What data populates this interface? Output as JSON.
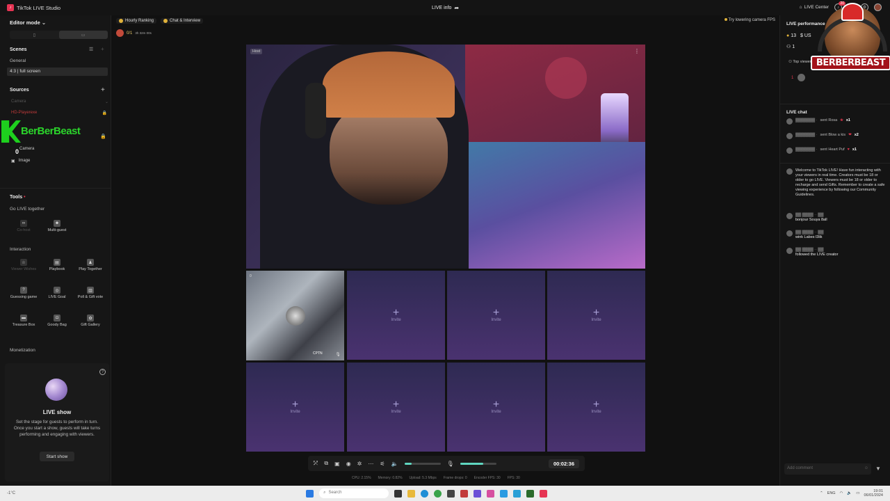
{
  "titlebar": {
    "app_title": "TikTok LIVE Studio",
    "center_title": "LIVE info",
    "live_center": "LIVE Center",
    "notification_count": "20"
  },
  "left": {
    "editor_mode": "Editor mode",
    "scenes_title": "Scenes",
    "scene_group": "General",
    "scene_item": "4:3 | full screen",
    "sources_title": "Sources",
    "sources": [
      "Camera",
      "HD-Playerexe",
      "Camera",
      "Image"
    ],
    "overlay_name": "BerBerBeast",
    "overlay_count": "0",
    "tools_title": "Tools",
    "go_live_together": "Go LIVE together",
    "tools_row1": [
      "Co-host",
      "Multi-guest"
    ],
    "interaction_title": "Interaction",
    "tools_interaction": [
      "Viewer Wishes",
      "Playbook",
      "Play Together",
      "Guessing game",
      "LIVE Goal",
      "Poll & Gift vote",
      "Treasure Box",
      "Goody Bag",
      "Gift Gallery"
    ],
    "monetization_title": "Monetization",
    "liveshow_title": "LIVE show",
    "liveshow_desc": "Set the stage for guests to perform in turn. Once you start a show, guests will take turns performing and engaging with viewers.",
    "start_show": "Start show"
  },
  "center": {
    "chips": [
      "Hourly Ranking",
      "Chat & Interview"
    ],
    "counter": "0/1",
    "counter_sub": "3h 32m 00s",
    "camera_tip": "Try lowering camera FPS",
    "cam_label": "Host",
    "invite_label": "Invite",
    "guest_count": "0",
    "guest_name": "CPTN",
    "timer": "00:02:36",
    "mic_level": 0.65,
    "vol_level": 0.2,
    "stats": [
      "CPU: 2.15%",
      "Memory: 0.82%",
      "Upload: 5.3 Mbps",
      "Frame drops: 0",
      "Encoder FPS: 30",
      "FPS: 30"
    ]
  },
  "right": {
    "perf_title": "LIVE performance",
    "perf_viewers": "13",
    "perf_currency": "US",
    "perf_row2": "1",
    "top_viewers": "Top viewers",
    "rank1": "1",
    "brand": "BERBERBEAST",
    "chat_title": "LIVE chat",
    "gifts": [
      {
        "text": "sent Rosa",
        "count": "x1"
      },
      {
        "text": "sent Blow a kis",
        "count": "x2"
      },
      {
        "text": "sent Heart Puf",
        "count": "x1"
      }
    ],
    "welcome": "Welcome to TikTok LIVE! Have fun interacting with your viewers in real time. Creators must be 18 or older to go LIVE. Viewers must be 18 or older to recharge and send Gifts. Remember to create a safe viewing experience by following our Community Guidelines.",
    "messages": [
      "bonjour Souya 8all",
      "wink Labes l3lik",
      "followed the LIVE creator"
    ],
    "comment_placeholder": "Add comment"
  },
  "taskbar": {
    "weather": "-1°C",
    "search": "Search",
    "lang": "ENG",
    "time": "19:01",
    "date": "06/01/2024"
  }
}
